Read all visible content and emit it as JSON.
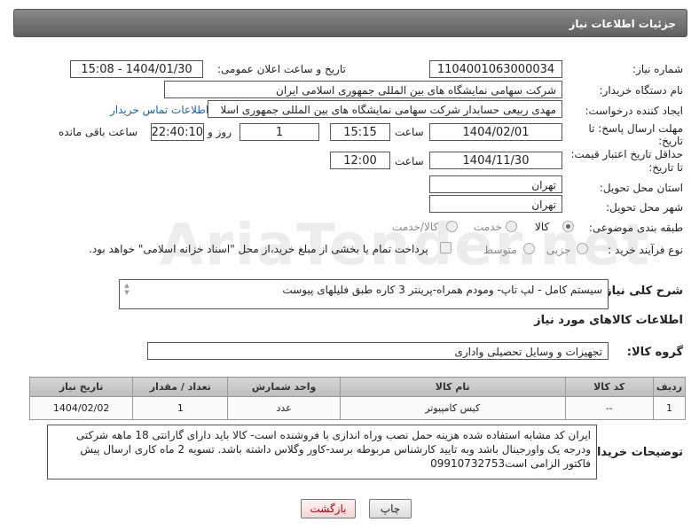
{
  "header": {
    "title": "جزئیات اطلاعات نیاز"
  },
  "need_number": {
    "label": "شماره نیاز:",
    "value": "1104001063000034"
  },
  "announce": {
    "label": "تاریخ و ساعت اعلان عمومی:",
    "value": "1404/01/30 - 15:08"
  },
  "buyer_org": {
    "label": "نام دستگاه خریدار:",
    "value": "شرکت سهامی نمایشگاه های بین المللی جمهوری اسلامی ایران"
  },
  "creator": {
    "label": "ایجاد کننده درخواست:",
    "value": "مهدی  ربیعی حسابدار شرکت سهامی نمایشگاه های بین المللی جمهوری اسلا",
    "contact_link": "اطلاعات تماس خریدار"
  },
  "deadline": {
    "label_line1": "مهلت ارسال پاسخ: تا",
    "label_line2": "تاریخ:",
    "date": "1404/02/01",
    "time_label": "ساعت",
    "time": "15:15",
    "days": "1",
    "days_label": "روز و",
    "remaining": "22:40:10",
    "remaining_label": "ساعت باقی مانده"
  },
  "validity": {
    "label_line1": "حداقل تاریخ اعتبار قیمت:",
    "label_line2": "تا تاریخ:",
    "date": "1404/11/30",
    "time_label": "ساعت",
    "time": "12:00"
  },
  "province": {
    "label": "استان محل تحویل:",
    "value": "تهران"
  },
  "city": {
    "label": "شهر محل تحویل:",
    "value": "تهران"
  },
  "category": {
    "label": "طبقه بندی موضوعی:",
    "options": [
      "کالا",
      "خدمت",
      "کالا/خدمت"
    ],
    "selected": "کالا"
  },
  "process": {
    "label": "نوع فرآیند خرید :",
    "options": [
      "جزیی",
      "متوسط"
    ],
    "selected": "جزیی",
    "payment_note": "پرداخت تمام یا بخشی از مبلغ خرید،از محل \"اسناد خزانه اسلامی\" خواهد بود."
  },
  "description": {
    "label": "شرح کلی نیاز:",
    "value": "سیستم کامل - لپ تاپ- ومودم همراه-پرینتر 3 کاره طبق فلیلهای پیوست"
  },
  "goods_info": {
    "title": "اطلاعات کالاهای مورد نیاز"
  },
  "goods_group": {
    "label": "گروه کالا:",
    "value": "تجهیزات و وسایل تحصیلی واداری"
  },
  "table": {
    "headers": [
      "ردیف",
      "کد کالا",
      "نام کالا",
      "واحد شمارش",
      "تعداد / مقدار",
      "تاریخ نیاز"
    ],
    "rows": [
      [
        "1",
        "--",
        "کیس کامپیوتر",
        "عدد",
        "1",
        "1404/02/02"
      ]
    ]
  },
  "buyer_notes": {
    "label": "توضیحات خریدار:",
    "value": "ایران کد مشابه استفاده شده هزینه حمل نصب وراه اندازی با فروشنده است- کالا باید دارای گارانتی 18 ماهه شرکتی ودرجه یک واورجینال باشد وبه تایید کارشناس مربوطه برسد-کاور وگلاس داشته باشد. تسویه 2 ماه کاری ارسال پیش فاکتور الزامی است09910732753"
  },
  "buttons": {
    "print": "چاپ",
    "back": "بازگشت"
  },
  "watermark": {
    "text": "AriaTender.net"
  }
}
